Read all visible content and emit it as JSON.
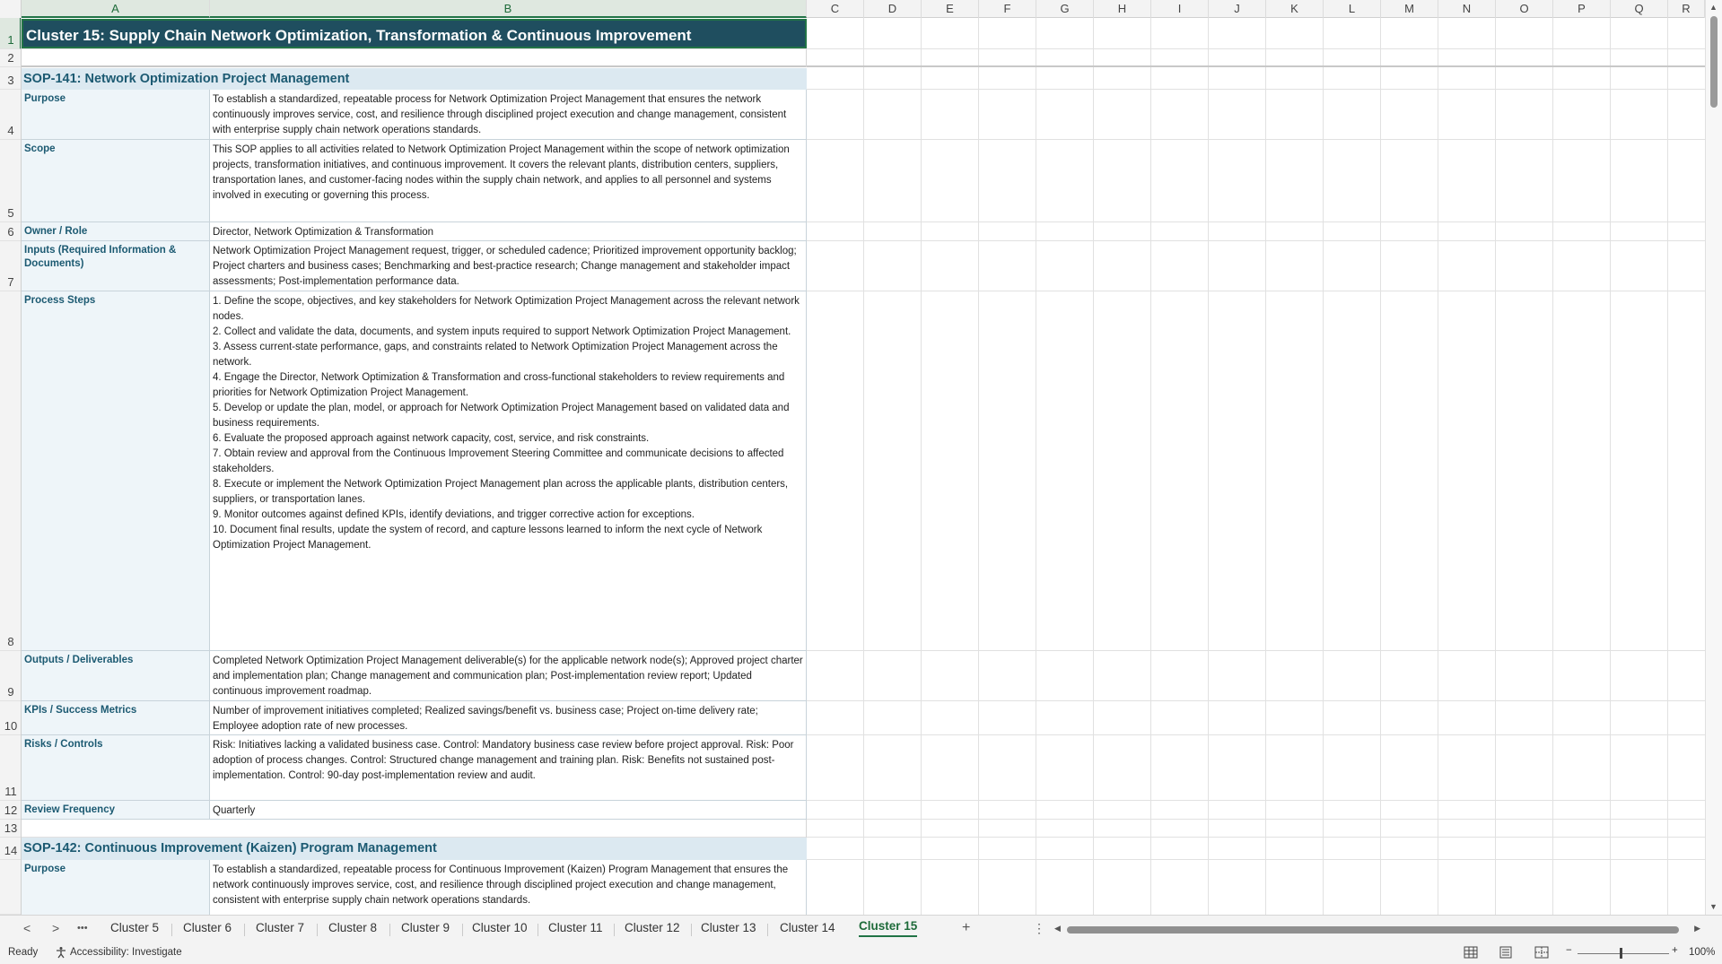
{
  "columns": [
    "A",
    "B",
    "C",
    "D",
    "E",
    "F",
    "G",
    "H",
    "I",
    "J",
    "K",
    "L",
    "M",
    "N",
    "O",
    "P",
    "Q",
    "R"
  ],
  "rows": [
    "1",
    "2",
    "3",
    "4",
    "5",
    "6",
    "7",
    "8",
    "9",
    "10",
    "11",
    "12",
    "13",
    "14"
  ],
  "title": "Cluster 15: Supply Chain Network Optimization, Transformation & Continuous Improvement",
  "sop141": {
    "header": "SOP-141: Network Optimization Project Management",
    "fields": [
      {
        "label": "Purpose",
        "value": "To establish a standardized, repeatable process for Network Optimization Project Management that ensures the network continuously improves service, cost, and resilience through disciplined project execution and change management, consistent with enterprise supply chain network operations standards."
      },
      {
        "label": "Scope",
        "value": "This SOP applies to all activities related to Network Optimization Project Management within the scope of network optimization projects, transformation initiatives, and continuous improvement. It covers the relevant plants, distribution centers, suppliers, transportation lanes, and customer-facing nodes within the supply chain network, and applies to all personnel and systems involved in executing or governing this process."
      },
      {
        "label": "Owner / Role",
        "value": "Director, Network Optimization & Transformation"
      },
      {
        "label": "Inputs (Required Information & Documents)",
        "value": "Network Optimization Project Management request, trigger, or scheduled cadence; Prioritized improvement opportunity backlog; Project charters and business cases; Benchmarking and best-practice research; Change management and stakeholder impact assessments; Post-implementation performance data."
      },
      {
        "label": "Process Steps",
        "value": "1. Define the scope, objectives, and key stakeholders for Network Optimization Project Management across the relevant network nodes.\n2. Collect and validate the data, documents, and system inputs required to support Network Optimization Project Management.\n3. Assess current-state performance, gaps, and constraints related to Network Optimization Project Management across the network.\n4. Engage the Director, Network Optimization & Transformation and cross-functional stakeholders to review requirements and priorities for Network Optimization Project Management.\n5. Develop or update the plan, model, or approach for Network Optimization Project Management based on validated data and business requirements.\n6. Evaluate the proposed approach against network capacity, cost, service, and risk constraints.\n7. Obtain review and approval from the Continuous Improvement Steering Committee and communicate decisions to affected stakeholders.\n8. Execute or implement the Network Optimization Project Management plan across the applicable plants, distribution centers, suppliers, or transportation lanes.\n9. Monitor outcomes against defined KPIs, identify deviations, and trigger corrective action for exceptions.\n10. Document final results, update the system of record, and capture lessons learned to inform the next cycle of Network Optimization Project Management."
      },
      {
        "label": "Outputs / Deliverables",
        "value": "Completed Network Optimization Project Management deliverable(s) for the applicable network node(s); Approved project charter and implementation plan; Change management and communication plan; Post-implementation review report; Updated continuous improvement roadmap."
      },
      {
        "label": "KPIs / Success Metrics",
        "value": "Number of improvement initiatives completed; Realized savings/benefit vs. business case; Project on-time delivery rate; Employee adoption rate of new processes."
      },
      {
        "label": "Risks / Controls",
        "value": "Risk: Initiatives lacking a validated business case. Control: Mandatory business case review before project approval. Risk: Poor adoption of process changes. Control: Structured change management and training plan. Risk: Benefits not sustained post-implementation. Control: 90-day post-implementation review and audit."
      },
      {
        "label": "Review Frequency",
        "value": "Quarterly"
      }
    ]
  },
  "sop142": {
    "header": "SOP-142: Continuous Improvement (Kaizen) Program Management",
    "purpose_label": "Purpose",
    "purpose_value": "To establish a standardized, repeatable process for Continuous Improvement (Kaizen) Program Management that ensures the network continuously improves service, cost, and resilience through disciplined project execution and change management, consistent with enterprise supply chain network operations standards."
  },
  "tabs": [
    "Cluster 5",
    "Cluster 6",
    "Cluster 7",
    "Cluster 8",
    "Cluster 9",
    "Cluster 10",
    "Cluster 11",
    "Cluster 12",
    "Cluster 13",
    "Cluster 14",
    "Cluster 15"
  ],
  "active_tab": "Cluster 15",
  "tab_nav": {
    "prev": "<",
    "next": ">",
    "more": "•••",
    "add": "+",
    "menu": "⋮"
  },
  "status": {
    "ready": "Ready",
    "accessibility": "Accessibility: Investigate",
    "zoom": "100%",
    "zoom_minus": "−",
    "zoom_plus": "+"
  }
}
